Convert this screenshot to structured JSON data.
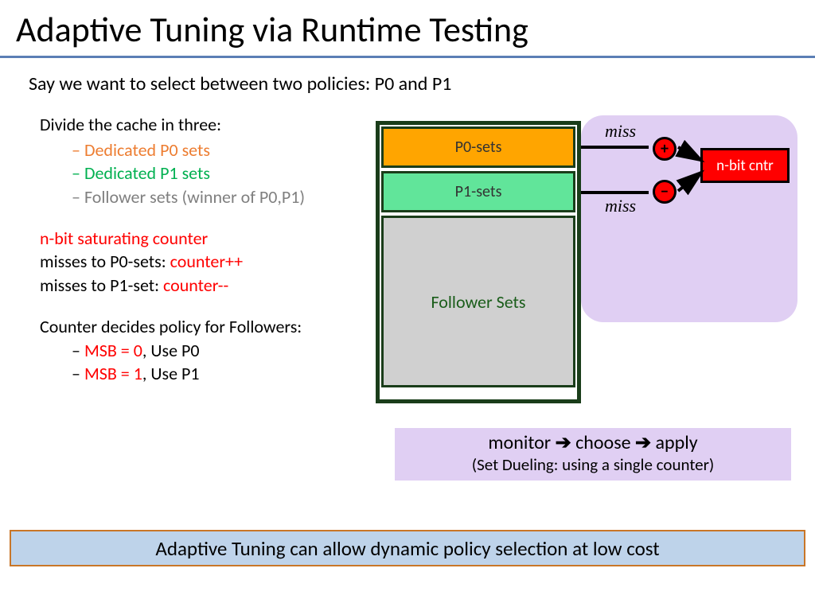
{
  "title": "Adaptive Tuning via Runtime Testing",
  "intro": "Say we want to select between two policies: P0 and P1",
  "left": {
    "divide": "Divide the cache in three:",
    "b1": "Dedicated P0 sets",
    "b2": "Dedicated P1 sets",
    "b3": "Follower sets (winner of P0,P1)",
    "counter_head": "n-bit saturating counter",
    "miss0_a": "misses to P0-sets: ",
    "miss0_b": "counter++",
    "miss1_a": "misses to P1-set: ",
    "miss1_b": "counter--",
    "decide": "Counter decides policy for Followers:",
    "msb0_a": "MSB = 0",
    "msb0_b": ", Use P0",
    "msb1_a": "MSB = 1",
    "msb1_b": ", Use P1"
  },
  "diagram": {
    "p0": "P0-sets",
    "p1": "P1-sets",
    "fol": "Follower Sets",
    "miss": "miss",
    "counter": "n-bit cntr",
    "plus": "+",
    "minus": "−"
  },
  "monitor": {
    "w1": "monitor",
    "w2": "choose",
    "w3": "apply",
    "sub": "(Set Dueling: using a single counter)"
  },
  "banner": "Adaptive Tuning can allow dynamic policy selection at low cost"
}
